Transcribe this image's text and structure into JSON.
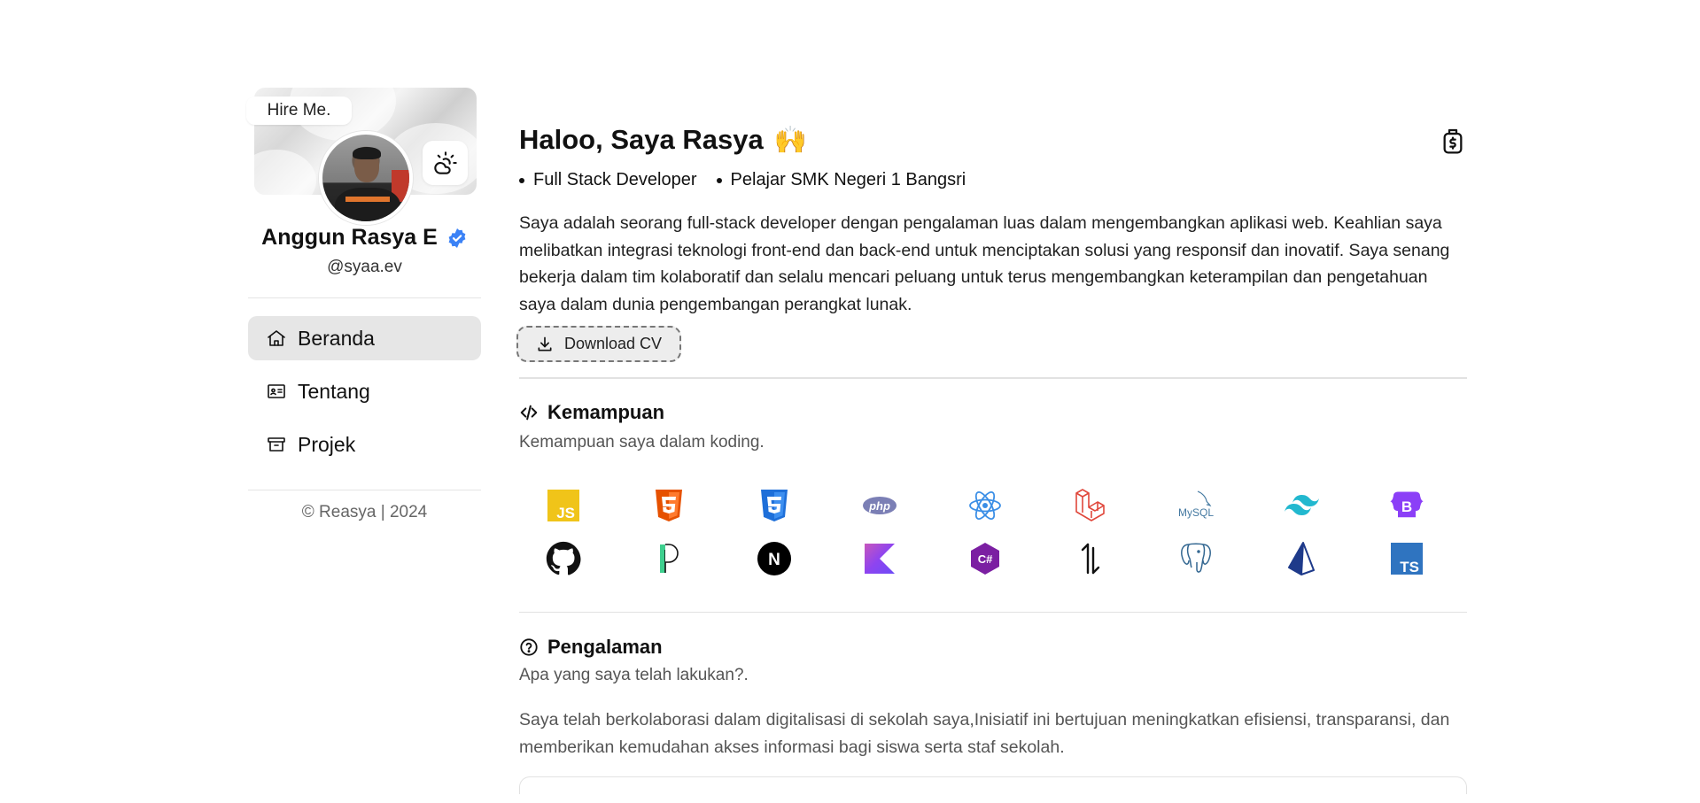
{
  "profile": {
    "hire_badge": "Hire Me.",
    "name": "Anggun Rasya E",
    "handle": "@syaa.ev"
  },
  "nav": {
    "items": [
      {
        "label": "Beranda",
        "icon": "home-icon",
        "active": true
      },
      {
        "label": "Tentang",
        "icon": "id-card-icon",
        "active": false
      },
      {
        "label": "Projek",
        "icon": "archive-box-icon",
        "active": false
      }
    ]
  },
  "footer": {
    "copyright": "© Reasya | 2024"
  },
  "hero": {
    "title": "Haloo, Saya Rasya",
    "emoji": "🙌",
    "roles": [
      "Full Stack Developer",
      "Pelajar SMK Negeri 1 Bangsri"
    ],
    "bio": "Saya adalah seorang full-stack developer dengan pengalaman luas dalam mengembangkan aplikasi web. Keahlian saya melibatkan integrasi teknologi front-end dan back-end untuk menciptakan solusi yang responsif dan inovatif. Saya senang bekerja dalam tim kolaboratif dan selalu mencari peluang untuk terus mengembangkan keterampilan dan pengetahuan saya dalam dunia pengembangan perangkat lunak.",
    "cv_button": "Download CV"
  },
  "skills": {
    "title": "Kemampuan",
    "subtitle": "Kemampuan saya dalam koding.",
    "items": [
      {
        "name": "javascript-icon",
        "color": "#f0c419"
      },
      {
        "name": "html5-icon",
        "color": "#e65100"
      },
      {
        "name": "css3-icon",
        "color": "#1e6fd9"
      },
      {
        "name": "php-icon",
        "color": "#7b7fb5"
      },
      {
        "name": "react-icon",
        "color": "#3a8ee6"
      },
      {
        "name": "laravel-icon",
        "color": "#e0473b"
      },
      {
        "name": "mysql-icon",
        "color": "#4479a1"
      },
      {
        "name": "tailwind-icon",
        "color": "#22b8cf"
      },
      {
        "name": "bootstrap-icon",
        "color": "#8b3ff7"
      },
      {
        "name": "github-icon",
        "color": "#111111"
      },
      {
        "name": "pinia-icon",
        "color": "#3ecf8e"
      },
      {
        "name": "nextjs-icon",
        "color": "#000000"
      },
      {
        "name": "kotlin-icon",
        "color": "#8e44f0"
      },
      {
        "name": "csharp-icon",
        "color": "#7b1fa2"
      },
      {
        "name": "ionic-icon",
        "color": "#111111"
      },
      {
        "name": "postgresql-icon",
        "color": "#336791"
      },
      {
        "name": "prisma-icon",
        "color": "#1e3a8a"
      },
      {
        "name": "typescript-icon",
        "color": "#2f74c0"
      }
    ],
    "icon_labels": {
      "js": "JS",
      "php": "php",
      "mysql": "MySQL",
      "b": "B",
      "n": "N",
      "csharp": "C#",
      "ts": "TS"
    }
  },
  "experience": {
    "title": "Pengalaman",
    "subtitle": "Apa yang saya telah lakukan?.",
    "text": "Saya telah berkolaborasi dalam digitalisasi di sekolah saya,Inisiatif ini bertujuan meningkatkan efisiensi, transparansi, dan memberikan kemudahan akses informasi bagi siswa serta staf sekolah."
  }
}
